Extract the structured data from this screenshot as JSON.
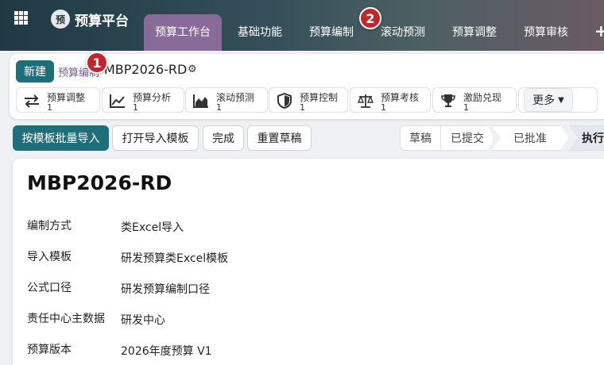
{
  "topbar": {
    "brand_logo": "预",
    "brand": "预算平台",
    "nav": [
      "预算工作台",
      "基础功能",
      "预算编制",
      "滚动预测",
      "预算调整",
      "预算审核"
    ],
    "add": "+"
  },
  "badges": [
    "1",
    "2"
  ],
  "breadcrumb": {
    "new": "新建",
    "parent": "预算编制",
    "current": "MBP2026-RD",
    "gear": "⚙"
  },
  "smart_buttons": [
    {
      "label": "预算调整",
      "count": "1",
      "icon": "arrows-swap-icon"
    },
    {
      "label": "预算分析",
      "count": "1",
      "icon": "line-chart-icon"
    },
    {
      "label": "滚动预测",
      "count": "1",
      "icon": "area-chart-icon"
    },
    {
      "label": "预算控制",
      "count": "1",
      "icon": "shield-icon"
    },
    {
      "label": "预算考核",
      "count": "1",
      "icon": "scale-icon"
    },
    {
      "label": "激励兑现",
      "count": "1",
      "icon": "trophy-icon"
    }
  ],
  "more": "更多",
  "actions": [
    "按模板批量导入",
    "打开导入模板",
    "完成",
    "重置草稿"
  ],
  "statuses": [
    "草稿",
    "已提交",
    "已批准",
    "执行"
  ],
  "form": {
    "title": "MBP2026-RD",
    "fields": [
      {
        "label": "编制方式",
        "value": "类Excel导入"
      },
      {
        "label": "导入模板",
        "value": "研发预算类Excel模板"
      },
      {
        "label": "公式口径",
        "value": "研发预算编制口径"
      },
      {
        "label": "责任中心主数据",
        "value": "研发中心"
      },
      {
        "label": "预算版本",
        "value": "2026年度预算 V1"
      }
    ]
  }
}
